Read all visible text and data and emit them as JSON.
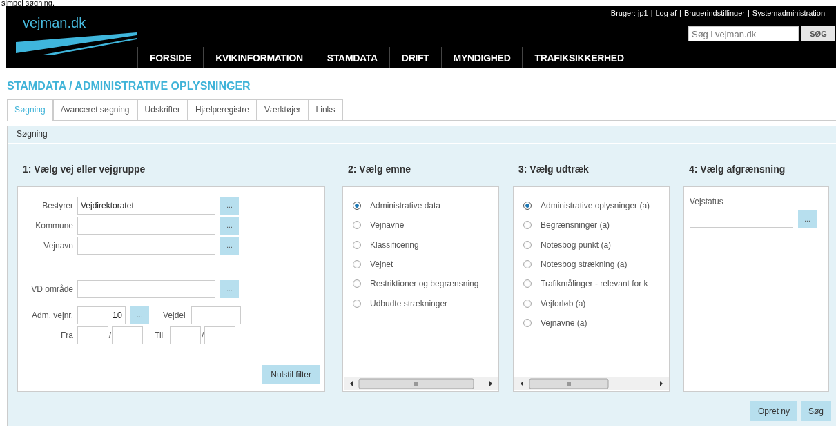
{
  "caption": "simpel søgning.",
  "header": {
    "logo": "vejman.dk",
    "user_bar": [
      {
        "kind": "text",
        "text": "Bruger: jp1"
      },
      {
        "kind": "sep",
        "text": "|"
      },
      {
        "kind": "link",
        "text": "Log af"
      },
      {
        "kind": "sep",
        "text": "|"
      },
      {
        "kind": "link",
        "text": "Brugerindstillinger"
      },
      {
        "kind": "sep",
        "text": "|"
      },
      {
        "kind": "link",
        "text": "Systemadministration"
      }
    ],
    "nav": [
      "FORSIDE",
      "KVIKINFORMATION",
      "STAMDATA",
      "DRIFT",
      "MYNDIGHED",
      "TRAFIKSIKKERHED"
    ],
    "search": {
      "placeholder": "Søg i vejman.dk",
      "button": "SØG"
    }
  },
  "page_title": "STAMDATA / ADMINISTRATIVE OPLYSNINGER",
  "tabs": [
    {
      "label": "Søgning",
      "selected": true
    },
    {
      "label": "Avanceret søgning",
      "selected": false
    },
    {
      "label": "Udskrifter",
      "selected": false
    },
    {
      "label": "Hjælperegistre",
      "selected": false
    },
    {
      "label": "Værktøjer",
      "selected": false
    },
    {
      "label": "Links",
      "selected": false
    }
  ],
  "panel": {
    "title": "Søgning",
    "section1": {
      "heading": "1: Vælg vej eller vejgruppe",
      "fields": [
        {
          "label": "Bestyrer",
          "value": "Vejdirektoratet",
          "button": "..."
        },
        {
          "label": "Kommune",
          "button": "..."
        },
        {
          "label": "Vejnavn",
          "button": "..."
        }
      ],
      "vd_field": {
        "label": "VD område",
        "button": "..."
      },
      "adm": {
        "label": "Adm. vejnr.",
        "value": "10",
        "button": "...",
        "vejdel_label": "Vejdel"
      },
      "range": {
        "from_label": "Fra",
        "from_sep": "/",
        "to_label": "Til",
        "to_sep": "/"
      },
      "reset_button": "Nulstil filter"
    },
    "section2": {
      "heading": "2: Vælg emne",
      "options": [
        {
          "label": "Administrative data",
          "selected": true
        },
        {
          "label": "Vejnavne",
          "selected": false
        },
        {
          "label": "Klassificering",
          "selected": false
        },
        {
          "label": "Vejnet",
          "selected": false
        },
        {
          "label": "Restriktioner og begrænsning",
          "selected": false
        },
        {
          "label": "Udbudte strækninger",
          "selected": false
        }
      ]
    },
    "section3": {
      "heading": "3: Vælg udtræk",
      "options": [
        {
          "label": "Administrative oplysninger (a)",
          "selected": true
        },
        {
          "label": "Begrænsninger (a)",
          "selected": false
        },
        {
          "label": "Notesbog punkt (a)",
          "selected": false
        },
        {
          "label": "Notesbog strækning (a)",
          "selected": false
        },
        {
          "label": "Trafikmålinger - relevant for k",
          "selected": false
        },
        {
          "label": "Vejforløb (a)",
          "selected": false
        },
        {
          "label": "Vejnavne (a)",
          "selected": false
        }
      ]
    },
    "section4": {
      "heading": "4: Vælg afgrænsning",
      "label": "Vejstatus",
      "button": "..."
    },
    "actions": [
      "Opret ny",
      "Søg"
    ]
  }
}
